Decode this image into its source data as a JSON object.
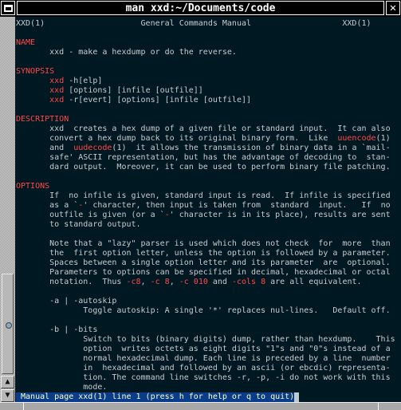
{
  "window": {
    "title": "man xxd:~/Documents/code",
    "close_glyph": "✕"
  },
  "scrollbar": {
    "position_percent": 0,
    "up_glyph": "▲",
    "down_glyph": "▼"
  },
  "colors": {
    "background": "#001822",
    "text": "#c8ccd0",
    "highlight": "#ff4848",
    "status_bg": "#0a3c8c",
    "status_text": "#ffffc0"
  },
  "lines": [
    [
      {
        "t": "XXD(1)                    General Commands Manual                   XXD(1)"
      }
    ],
    [
      {
        "t": ""
      }
    ],
    [
      {
        "t": "NAME",
        "r": 1
      }
    ],
    [
      {
        "t": "       xxd - make a hexdump or do the reverse."
      }
    ],
    [
      {
        "t": ""
      }
    ],
    [
      {
        "t": "SYNOPSIS",
        "r": 1
      }
    ],
    [
      {
        "t": "       "
      },
      {
        "t": "xxd",
        "r": 1
      },
      {
        "t": " -h[elp]"
      }
    ],
    [
      {
        "t": "       "
      },
      {
        "t": "xxd",
        "r": 1
      },
      {
        "t": " [options] [infile [outfile]]"
      }
    ],
    [
      {
        "t": "       "
      },
      {
        "t": "xxd",
        "r": 1
      },
      {
        "t": " -r[evert] [options] [infile [outfile]]"
      }
    ],
    [
      {
        "t": ""
      }
    ],
    [
      {
        "t": "DESCRIPTION",
        "r": 1
      }
    ],
    [
      {
        "t": "       xxd  creates a hex dump of a given file or standard input.  It can also"
      }
    ],
    [
      {
        "t": "       convert a hex dump back to its original binary form.  Like  "
      },
      {
        "t": "uuencode",
        "r": 1
      },
      {
        "t": "(1)"
      }
    ],
    [
      {
        "t": "       and  "
      },
      {
        "t": "uudecode",
        "r": 1
      },
      {
        "t": "(1)  it allows the transmission of binary data in a `mail-"
      }
    ],
    [
      {
        "t": "       safe' ASCII representation, but has the advantage of decoding to  stan‐"
      }
    ],
    [
      {
        "t": "       dard output.  Moreover, it can be used to perform binary file patching."
      }
    ],
    [
      {
        "t": ""
      }
    ],
    [
      {
        "t": "OPTIONS",
        "r": 1
      }
    ],
    [
      {
        "t": "       If  no infile is given, standard input is read.  If infile is specified"
      }
    ],
    [
      {
        "t": "       as a `"
      },
      {
        "t": "-",
        "r": 1
      },
      {
        "t": "' character, then input is taken from  standard  input.   If  no"
      }
    ],
    [
      {
        "t": "       outfile is given (or a `"
      },
      {
        "t": "-",
        "r": 1
      },
      {
        "t": "' character is in its place), results are sent"
      }
    ],
    [
      {
        "t": "       to standard output."
      }
    ],
    [
      {
        "t": ""
      }
    ],
    [
      {
        "t": "       Note that a \"lazy\" parser is used which does not check  for  more  than"
      }
    ],
    [
      {
        "t": "       the  first option letter, unless the option is followed by a parameter."
      }
    ],
    [
      {
        "t": "       Spaces between a single option letter and its parameter  are  optional."
      }
    ],
    [
      {
        "t": "       Parameters to options can be specified in decimal, hexadecimal or octal"
      }
    ],
    [
      {
        "t": "       notation.  Thus "
      },
      {
        "t": "-c8",
        "r": 1
      },
      {
        "t": ", "
      },
      {
        "t": "-c 8",
        "r": 1
      },
      {
        "t": ", "
      },
      {
        "t": "-c 010",
        "r": 1
      },
      {
        "t": " and "
      },
      {
        "t": "-cols 8",
        "r": 1
      },
      {
        "t": " are all equivalent."
      }
    ],
    [
      {
        "t": ""
      }
    ],
    [
      {
        "t": "       -a | -autoskip"
      }
    ],
    [
      {
        "t": "              Toggle autoskip: A single '*' replaces nul-lines.   Default off."
      }
    ],
    [
      {
        "t": ""
      }
    ],
    [
      {
        "t": "       -b | -bits"
      }
    ],
    [
      {
        "t": "              Switch to bits (binary digits) dump, rather than hexdump.    This"
      }
    ],
    [
      {
        "t": "              option  writes octets as eight digits \"1\"s and \"0\"s instead of a"
      }
    ],
    [
      {
        "t": "              normal hexadecimal dump. Each line is preceded by a line  number"
      }
    ],
    [
      {
        "t": "              in  hexadecimal and followed by an ascii (or ebcdic) representa‐"
      }
    ],
    [
      {
        "t": "              tion. The command line switches -r, -p, -i do not work with this"
      }
    ],
    [
      {
        "t": "              mode."
      }
    ]
  ],
  "status": " Manual page xxd(1) line 1 (press h for help or q to quit)"
}
